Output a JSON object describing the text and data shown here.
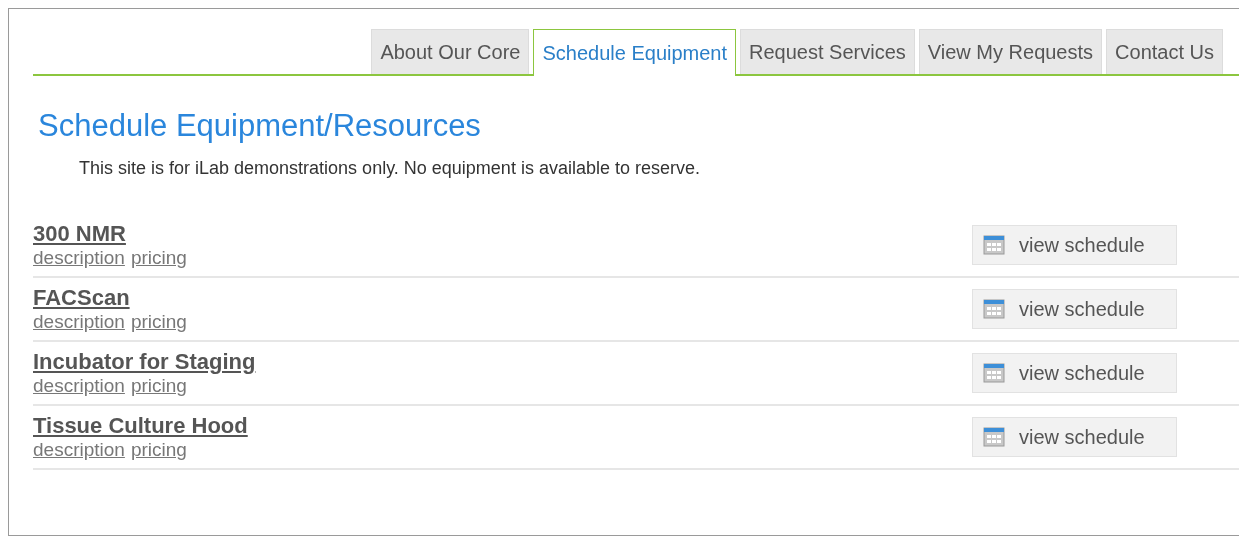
{
  "tabs": [
    {
      "label": "About Our Core",
      "selected": false
    },
    {
      "label": "Schedule Equipment",
      "selected": true
    },
    {
      "label": "Request Services",
      "selected": false
    },
    {
      "label": "View My Requests",
      "selected": false
    },
    {
      "label": "Contact Us",
      "selected": false
    }
  ],
  "heading": "Schedule Equipment/Resources",
  "notice": "This site is for iLab demonstrations only. No equipment is available to reserve.",
  "equipment": [
    {
      "name": "300 NMR",
      "links": [
        "description",
        "pricing"
      ],
      "button": "view schedule"
    },
    {
      "name": "FACScan",
      "links": [
        "description",
        "pricing"
      ],
      "button": "view schedule"
    },
    {
      "name": "Incubator for Staging",
      "links": [
        "description",
        "pricing"
      ],
      "button": "view schedule"
    },
    {
      "name": "Tissue Culture Hood",
      "links": [
        "description",
        "pricing"
      ],
      "button": "view schedule"
    }
  ]
}
